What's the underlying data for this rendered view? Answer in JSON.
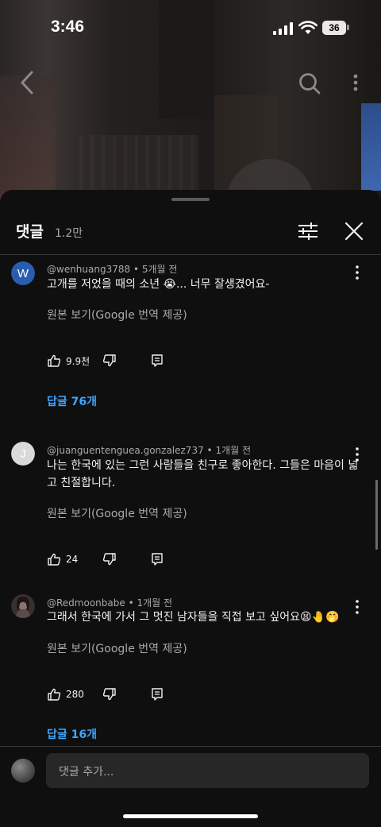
{
  "status_bar": {
    "time": "3:46",
    "battery": "36"
  },
  "top_bar": {
    "back_icon": "chevron-left-icon",
    "search_icon": "search-icon",
    "more_icon": "more-vertical-icon"
  },
  "sheet": {
    "title": "댓글",
    "count": "1.2만",
    "filter_icon": "sliders-icon",
    "close_icon": "close-icon"
  },
  "comments": [
    {
      "avatar_letter": "W",
      "avatar_color": "#2a5db0",
      "author": "@wenhuang3788",
      "time": "5개월 전",
      "text": "고개를 저었을 때의 소년 😭... 너무 잘생겼어요-",
      "translate_label": "원본 보기(Google 번역 제공)",
      "likes": "9.9천",
      "replies": "답글 76개"
    },
    {
      "avatar_letter": "J",
      "avatar_color": "#d9d9d9",
      "author": "@juanguentenguea.gonzalez737",
      "time": "1개월 전",
      "text": "나는 한국에 있는 그런 사람들을 친구로 좋아한다. 그들은 마음이 넓고 친절합니다.",
      "translate_label": "원본 보기(Google 번역 제공)",
      "likes": "24",
      "replies": ""
    },
    {
      "avatar_letter": "",
      "avatar_color": "#6b5a58",
      "author": "@Redmoonbabe",
      "time": "1개월 전",
      "text": "그래서 한국에 가서 그 멋진 남자들을 직접 보고 싶어요😫🤚🤭",
      "translate_label": "원본 보기(Google 번역 제공)",
      "likes": "280",
      "replies": "답글 16개"
    }
  ],
  "add_comment": {
    "placeholder": "댓글 추가..."
  },
  "colors": {
    "accent": "#3ea6ff",
    "background": "#0f0f0f",
    "input_bg": "#272727"
  }
}
